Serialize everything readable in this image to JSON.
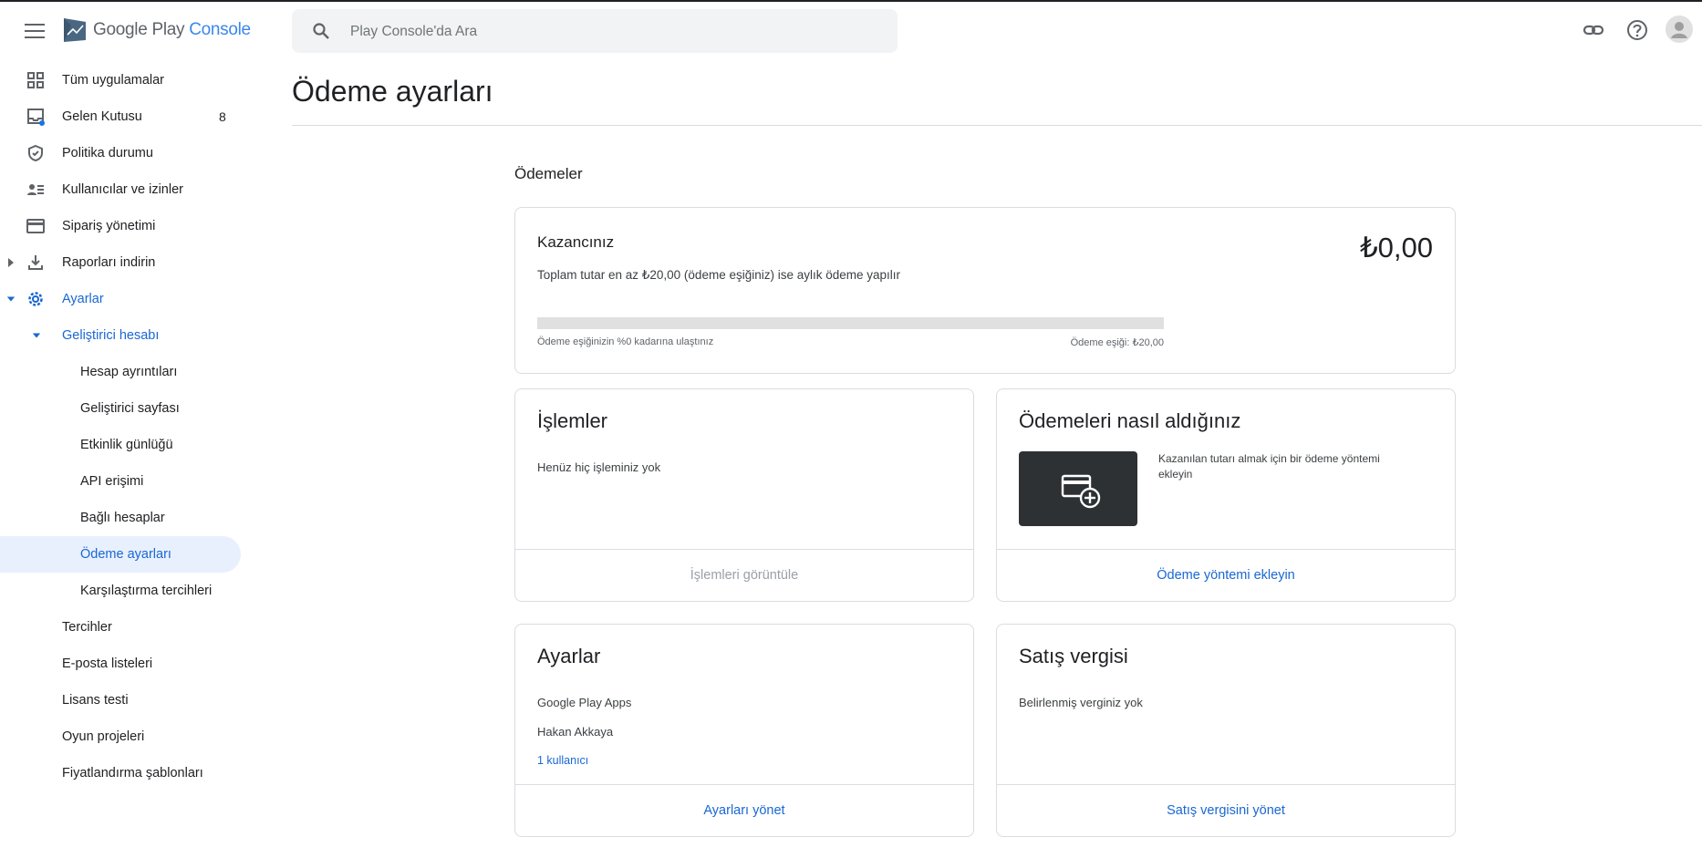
{
  "app": {
    "logo_brand": "Google Play",
    "logo_product": "Console"
  },
  "search": {
    "placeholder": "Play Console'da Ara"
  },
  "sidebar": {
    "items": [
      {
        "label": "Tüm uygulamalar"
      },
      {
        "label": "Gelen Kutusu",
        "count": "8"
      },
      {
        "label": "Politika durumu"
      },
      {
        "label": "Kullanıcılar ve izinler"
      },
      {
        "label": "Sipariş yönetimi"
      },
      {
        "label": "Raporları indirin"
      },
      {
        "label": "Ayarlar"
      },
      {
        "label": "Geliştirici hesabı"
      },
      {
        "label": "Hesap ayrıntıları"
      },
      {
        "label": "Geliştirici sayfası"
      },
      {
        "label": "Etkinlik günlüğü"
      },
      {
        "label": "API erişimi"
      },
      {
        "label": "Bağlı hesaplar"
      },
      {
        "label": "Ödeme ayarları"
      },
      {
        "label": "Karşılaştırma tercihleri"
      },
      {
        "label": "Tercihler"
      },
      {
        "label": "E-posta listeleri"
      },
      {
        "label": "Lisans testi"
      },
      {
        "label": "Oyun projeleri"
      },
      {
        "label": "Fiyatlandırma şablonları"
      }
    ]
  },
  "main": {
    "title": "Ödeme ayarları",
    "section": "Ödemeler",
    "earnings": {
      "label": "Kazancınız",
      "amount": "₺0,00",
      "description": "Toplam tutar en az ₺20,00 (ödeme eşiğiniz) ise aylık ödeme yapılır",
      "progress_fraction": 0,
      "progress_left": "Ödeme eşiğinizin %0 kadarına ulaştınız",
      "progress_right": "Ödeme eşiği: ₺20,00"
    },
    "transactions": {
      "title": "İşlemler",
      "empty": "Henüz hiç işleminiz yok",
      "action": "İşlemleri görüntüle"
    },
    "payments": {
      "title": "Ödemeleri nasıl aldığınız",
      "description": "Kazanılan tutarı almak için bir ödeme yöntemi ekleyin",
      "action": "Ödeme yöntemi ekleyin"
    },
    "settings": {
      "title": "Ayarlar",
      "line1": "Google Play Apps",
      "line2": "Hakan Akkaya",
      "users_link": "1 kullanıcı",
      "action": "Ayarları yönet"
    },
    "sales_tax": {
      "title": "Satış vergisi",
      "empty": "Belirlenmiş verginiz yok",
      "action": "Satış vergisini yönet"
    }
  },
  "colors": {
    "accent": "#1a73e8",
    "active_bg": "#e8f0fe",
    "tile_dark": "#2d3134"
  }
}
